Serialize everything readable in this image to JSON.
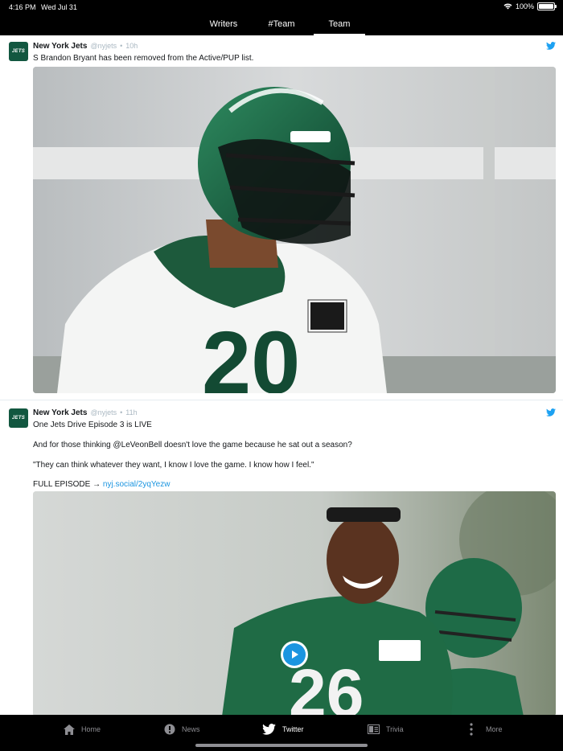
{
  "status": {
    "time": "4:16 PM",
    "date": "Wed Jul 31",
    "battery": "100%"
  },
  "tabs": [
    {
      "label": "Writers"
    },
    {
      "label": "#Team"
    },
    {
      "label": "Team",
      "active": true
    }
  ],
  "tweets": [
    {
      "avatar_text": "JETS",
      "name": "New York Jets",
      "handle": "@nyjets",
      "dot": "•",
      "age": "10h",
      "text": "S Brandon Bryant has been removed from the Active/PUP list.",
      "media": "photo"
    },
    {
      "avatar_text": "JETS",
      "name": "New York Jets",
      "handle": "@nyjets",
      "dot": "•",
      "age": "11h",
      "lines": [
        "One Jets Drive Episode 3 is LIVE",
        "And for those thinking @LeVeonBell doesn't love the game because he sat out a season?",
        "\"They can think whatever they want, I know I love the game. I know how I feel.\""
      ],
      "link_prefix": "FULL EPISODE →",
      "link": "nyj.social/2yqYezw",
      "media": "video"
    }
  ],
  "bottom_nav": [
    {
      "label": "Home",
      "icon": "home-icon"
    },
    {
      "label": "News",
      "icon": "news-icon"
    },
    {
      "label": "Twitter",
      "icon": "twitter-bird-icon",
      "active": true
    },
    {
      "label": "Trivia",
      "icon": "trivia-icon"
    },
    {
      "label": "More",
      "icon": "more-icon"
    }
  ],
  "colors": {
    "brand": "#125740",
    "accent": "#1b95e0",
    "bar": "#000000"
  }
}
